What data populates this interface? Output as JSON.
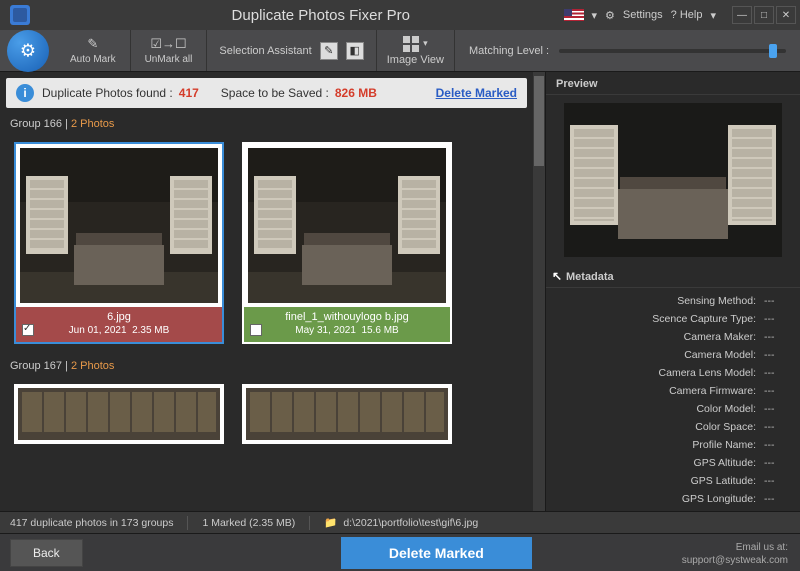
{
  "titlebar": {
    "title": "Duplicate Photos Fixer Pro",
    "settings": "Settings",
    "help": "? Help"
  },
  "toolbar": {
    "automark": "Auto Mark",
    "unmark": "UnMark all",
    "sel_assist": "Selection Assistant",
    "image_view": "Image View",
    "match_level": "Matching Level :"
  },
  "info": {
    "found_label": "Duplicate Photos found :",
    "found_count": "417",
    "space_label": "Space to be Saved :",
    "space_value": "826 MB",
    "delete_marked": "Delete Marked"
  },
  "groups": [
    {
      "name": "Group 166",
      "count": "2",
      "photos_label": "Photos",
      "items": [
        {
          "fn": "6.jpg",
          "date": "Jun 01, 2021",
          "size": "2.35 MB",
          "selected": true
        },
        {
          "fn": "finel_1_withouylogo b.jpg",
          "date": "May 31, 2021",
          "size": "15.6 MB",
          "selected": false
        }
      ]
    },
    {
      "name": "Group 167",
      "count": "2",
      "photos_label": "Photos"
    }
  ],
  "side": {
    "preview": "Preview",
    "metadata": "Metadata",
    "rows": [
      {
        "k": "Sensing Method:",
        "v": "---"
      },
      {
        "k": "Scence Capture Type:",
        "v": "---"
      },
      {
        "k": "Camera Maker:",
        "v": "---"
      },
      {
        "k": "Camera Model:",
        "v": "---"
      },
      {
        "k": "Camera Lens Model:",
        "v": "---"
      },
      {
        "k": "Camera Firmware:",
        "v": "---"
      },
      {
        "k": "Color Model:",
        "v": "---"
      },
      {
        "k": "Color Space:",
        "v": "---"
      },
      {
        "k": "Profile Name:",
        "v": "---"
      },
      {
        "k": "GPS Altitude:",
        "v": "---"
      },
      {
        "k": "GPS Latitude:",
        "v": "---"
      },
      {
        "k": "GPS Longitude:",
        "v": "---"
      }
    ]
  },
  "status": {
    "summary": "417 duplicate photos in 173 groups",
    "marked": "1 Marked (2.35 MB)",
    "path": "d:\\2021\\portfolio\\test\\gif\\6.jpg"
  },
  "bottom": {
    "back": "Back",
    "delete": "Delete Marked",
    "email_lbl": "Email us at:",
    "email": "support@systweak.com"
  }
}
